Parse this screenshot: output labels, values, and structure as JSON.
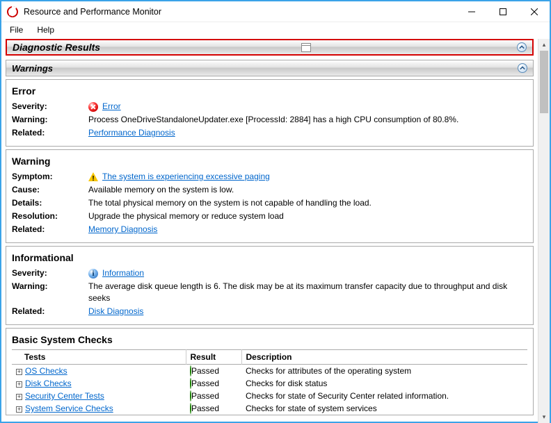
{
  "window": {
    "title": "Resource and Performance Monitor"
  },
  "menu": {
    "file": "File",
    "help": "Help"
  },
  "headers": {
    "diagnostic": "Diagnostic Results",
    "warnings": "Warnings"
  },
  "error_panel": {
    "heading": "Error",
    "rows": {
      "severity_label": "Severity:",
      "severity_value": "Error",
      "warning_label": "Warning:",
      "warning_value": "Process OneDriveStandaloneUpdater.exe [ProcessId: 2884] has a high CPU consumption of 80.8%.",
      "related_label": "Related:",
      "related_link": "Performance Diagnosis"
    }
  },
  "warning_panel": {
    "heading": "Warning",
    "rows": {
      "symptom_label": "Symptom:",
      "symptom_value": "The system is experiencing excessive paging",
      "cause_label": "Cause:",
      "cause_value": "Available memory on the system is low.",
      "details_label": "Details:",
      "details_value": "The total physical memory on the system is not capable of handling the load.",
      "resolution_label": "Resolution:",
      "resolution_value": "Upgrade the physical memory or reduce system load",
      "related_label": "Related:",
      "related_link": "Memory Diagnosis"
    }
  },
  "info_panel": {
    "heading": "Informational",
    "rows": {
      "severity_label": "Severity:",
      "severity_value": "Information",
      "warning_label": "Warning:",
      "warning_value": "The average disk queue length is 6. The disk may be at its maximum transfer capacity due to throughput and disk seeks",
      "related_label": "Related:",
      "related_link": "Disk Diagnosis"
    }
  },
  "basic_checks": {
    "heading": "Basic System Checks",
    "columns": {
      "tests": "Tests",
      "result": "Result",
      "description": "Description"
    },
    "rows": {
      "0": {
        "name": "OS Checks",
        "result": "Passed",
        "desc": "Checks for attributes of the operating system"
      },
      "1": {
        "name": "Disk Checks",
        "result": "Passed",
        "desc": "Checks for disk status"
      },
      "2": {
        "name": "Security Center Tests",
        "result": "Passed",
        "desc": "Checks for state of Security Center related information."
      },
      "3": {
        "name": "System Service Checks",
        "result": "Passed",
        "desc": "Checks for state of system services"
      }
    }
  }
}
